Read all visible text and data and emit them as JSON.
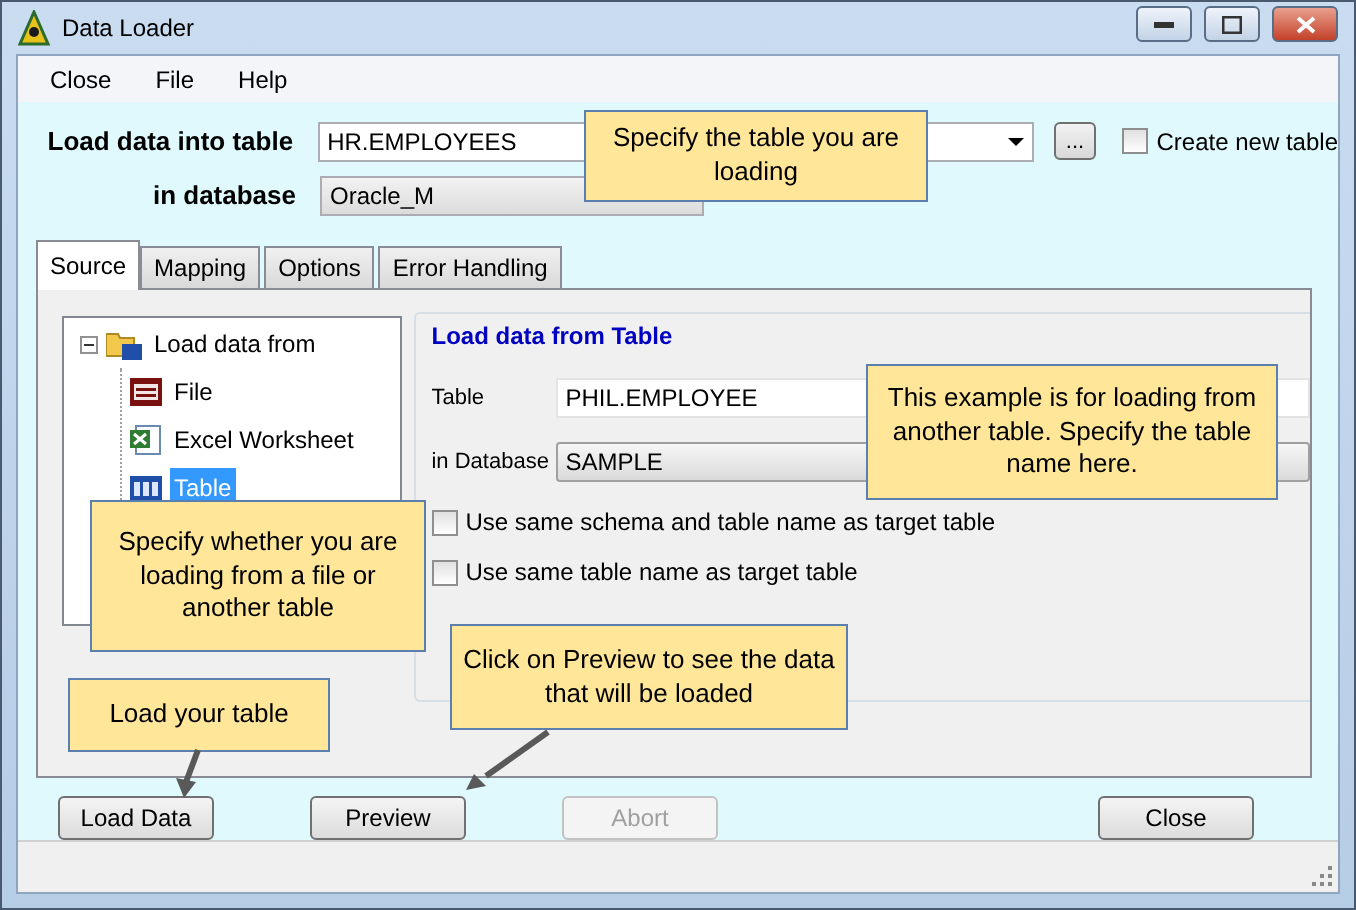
{
  "window": {
    "title": "Data Loader"
  },
  "menu": [
    "Close",
    "File",
    "Help"
  ],
  "target": {
    "table_label": "Load data into table",
    "table_value": "HR.EMPLOYEES",
    "browse_button": "...",
    "create_new": {
      "label": "Create new table",
      "checked": false
    },
    "database_label": "in database",
    "database_value": "Oracle_M"
  },
  "tabs": [
    {
      "label": "Source",
      "selected": true
    },
    {
      "label": "Mapping",
      "selected": false
    },
    {
      "label": "Options",
      "selected": false
    },
    {
      "label": "Error Handling",
      "selected": false
    }
  ],
  "tree": {
    "label": "Load data from",
    "expanded": true,
    "children": [
      {
        "label": "File",
        "kind": "csv",
        "selected": false
      },
      {
        "label": "Excel Worksheet",
        "kind": "excel",
        "selected": false
      },
      {
        "label": "Table",
        "kind": "table",
        "selected": true
      }
    ]
  },
  "source_group": {
    "title": "Load data from Table",
    "table_label": "Table",
    "table_value": "PHIL.EMPLOYEE",
    "database_label": "in Database",
    "database_value": "SAMPLE",
    "options": [
      {
        "label": "Use same schema and table name as target table",
        "checked": false
      },
      {
        "label": "Use same table name as target table",
        "checked": false
      }
    ]
  },
  "buttons": [
    {
      "label": "Load Data",
      "disabled": false
    },
    {
      "label": "Preview",
      "disabled": false
    },
    {
      "label": "Abort",
      "disabled": true
    },
    {
      "label": "Close",
      "disabled": false
    }
  ],
  "callouts": [
    {
      "text": "Specify the table you are loading"
    },
    {
      "text": "This example is for loading from another table. Specify the table name here."
    },
    {
      "text": "Specify whether you are loading from a file or another table"
    },
    {
      "text": "Click on Preview to see the data that will be loaded"
    },
    {
      "text": "Load your table"
    }
  ]
}
